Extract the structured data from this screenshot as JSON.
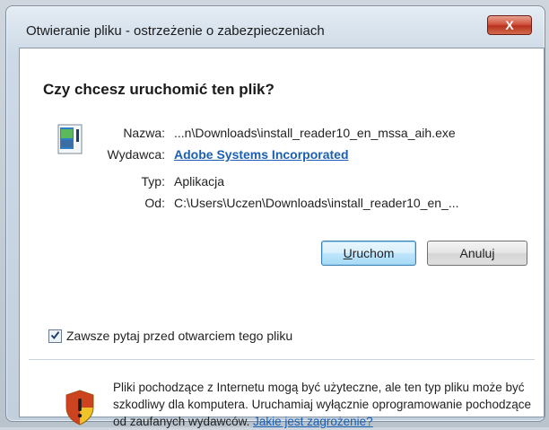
{
  "window": {
    "title": "Otwieranie pliku - ostrzeżenie o zabezpieczeniach",
    "close_label": "X"
  },
  "dialog": {
    "heading": "Czy chcesz uruchomić ten plik?",
    "fields": {
      "name_label": "Nazwa:",
      "name_value": "...n\\Downloads\\install_reader10_en_mssa_aih.exe",
      "publisher_label": "Wydawca:",
      "publisher_value": "Adobe Systems Incorporated",
      "type_label": "Typ:",
      "type_value": "Aplikacja",
      "from_label": "Od:",
      "from_value": "C:\\Users\\Uczen\\Downloads\\install_reader10_en_..."
    },
    "buttons": {
      "run_label": "Uruchom",
      "cancel_label": "Anuluj"
    },
    "checkbox": {
      "label": "Zawsze pytaj przed otwarciem tego pliku",
      "checked": true
    },
    "warning": {
      "text": "Pliki pochodzące z Internetu mogą być użyteczne, ale ten typ pliku może być szkodliwy dla komputera. Uruchamiaj wyłącznie oprogramowanie pochodzące od zaufanych wydawców.",
      "link": "Jakie jest zagrożenie?"
    }
  },
  "colors": {
    "link": "#1a5fb4",
    "close_button": "#c8412a",
    "shield_yellow": "#f2c229",
    "shield_red": "#c62d1f"
  },
  "icons": {
    "file": "application-file-icon",
    "warning": "security-shield-icon",
    "check": "checkmark-icon"
  }
}
